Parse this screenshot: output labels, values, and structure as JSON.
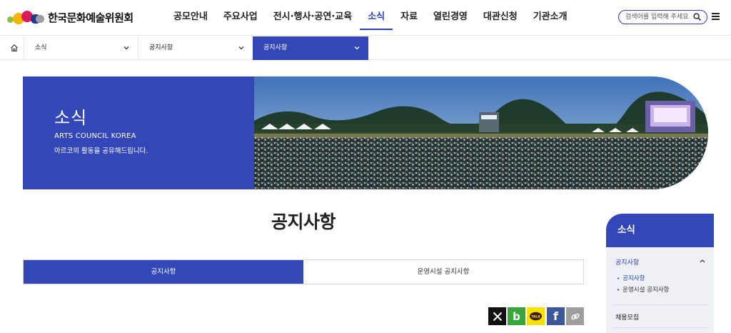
{
  "header": {
    "logo_text": "한국문화예술위원회",
    "nav": [
      "공모안내",
      "주요사업",
      "전시·행사·공연·교육",
      "소식",
      "자료",
      "열린경영",
      "대관신청",
      "기관소개"
    ],
    "active_nav": "소식",
    "search_placeholder": "검색어를 입력해 주세요."
  },
  "location": {
    "level1": "소식",
    "level2": "공지사항",
    "level3": "공지사항"
  },
  "banner": {
    "title": "소식",
    "subtitle_en": "ARTS COUNCIL KOREA",
    "subtitle_ko": "아르코의 활동을 공유해드립니다."
  },
  "page": {
    "title": "공지사항",
    "tabs": [
      {
        "label": "공지사항",
        "active": true
      },
      {
        "label": "운영시설 공지사항",
        "active": false
      }
    ]
  },
  "share": {
    "kakao_label": "TALK"
  },
  "side_menu": {
    "title": "소식",
    "section": "공지사항",
    "sub_items": [
      "공지사항",
      "운영시설 공지사항"
    ],
    "next_item": "채용모집"
  },
  "colors": {
    "brand": "#3347b8",
    "accent": "#2a3fb3"
  }
}
